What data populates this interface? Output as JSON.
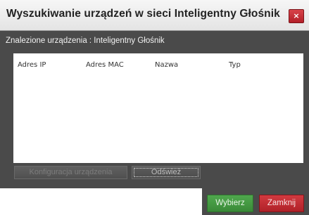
{
  "window": {
    "title": "Wyszukiwanie urządzeń w sieci Inteligentny Głośnik",
    "close_glyph": "×"
  },
  "subtitle": "Znalezione urządzenia : Inteligentny Głośnik",
  "device_list": {
    "columns": [
      "Adres IP",
      "Adres MAC",
      "Nazwa",
      "Typ"
    ],
    "rows": []
  },
  "buttons": {
    "config_label": "Konfiguracja urządzenia",
    "refresh_label": "Odśwież",
    "select_label": "Wybierz",
    "close_label": "Zamknij"
  },
  "colors": {
    "dialog_background": "#4a4a4a",
    "select_button": "#3f9a3d",
    "close_button": "#c2262d"
  }
}
